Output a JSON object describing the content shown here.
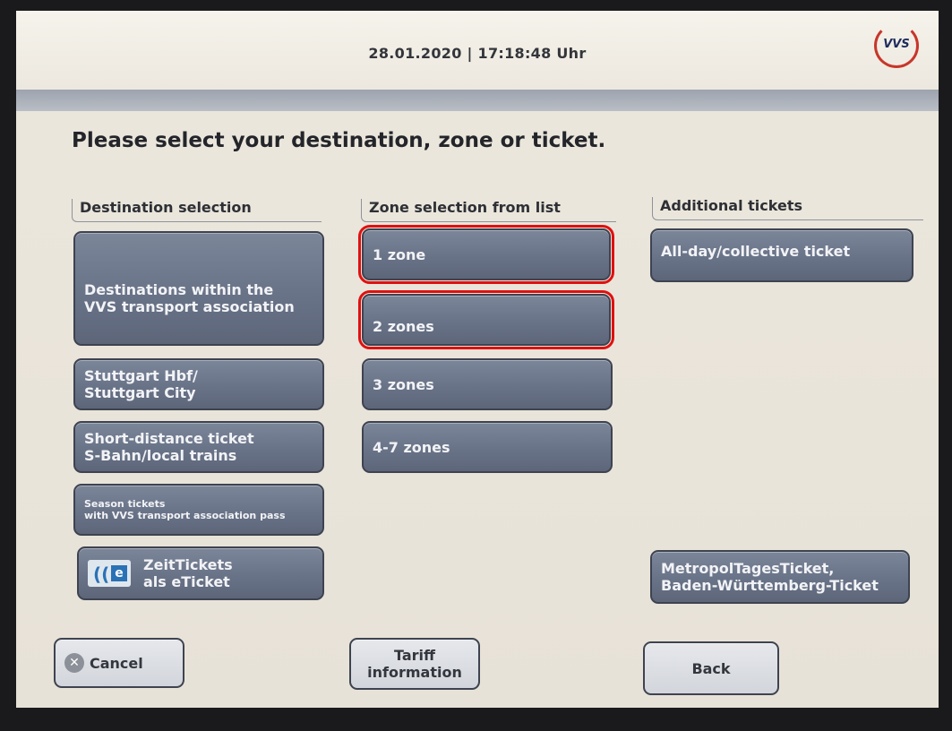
{
  "header": {
    "datetime": "28.01.2020 | 17:18:48 Uhr",
    "logo_text": "VVS"
  },
  "headline": "Please select your destination, zone or ticket.",
  "columns": {
    "destination": {
      "title": "Destination selection",
      "buttons": [
        "Destinations within the\nVVS transport association",
        "Stuttgart Hbf/\nStuttgart City",
        "Short-distance ticket\nS-Bahn/local trains",
        "Season tickets\nwith VVS transport association pass",
        "ZeitTickets\nals eTicket"
      ]
    },
    "zone": {
      "title": "Zone selection from list",
      "buttons": [
        "1 zone",
        "2 zones",
        "3 zones",
        "4-7 zones"
      ],
      "highlighted": [
        "1 zone",
        "2 zones"
      ],
      "highlight_color": "#e01010"
    },
    "additional": {
      "title": "Additional tickets",
      "buttons": [
        "All-day/collective ticket",
        "MetropolTagesTicket,\nBaden-Württemberg-Ticket"
      ]
    }
  },
  "footer": {
    "cancel": "Cancel",
    "tariff": "Tariff\ninformation",
    "back": "Back"
  },
  "colors": {
    "button_blue": "#6b7589",
    "background": "#ece7dd",
    "brand_red": "#c8362a"
  }
}
